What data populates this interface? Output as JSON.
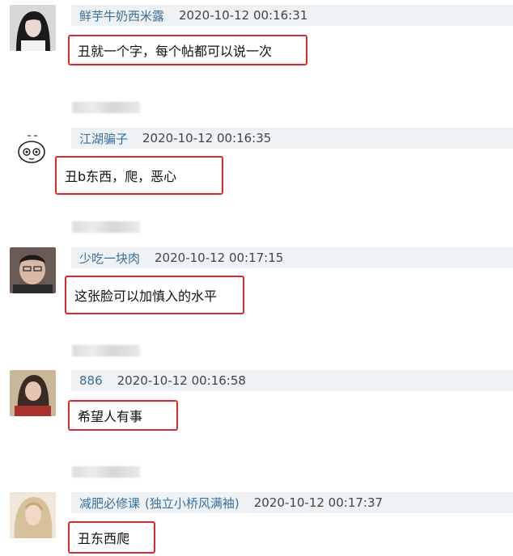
{
  "comments": [
    {
      "username": "鲜芋牛奶西米露",
      "username_suffix": "",
      "timestamp": "2020-10-12 00:16:31",
      "content": "丑就一个字，每个帖都可以说一次",
      "avatar_icon": "girl-portrait-avatar"
    },
    {
      "username": "江湖骗子",
      "username_suffix": "",
      "timestamp": "2020-10-12 00:16:35",
      "content": "丑b东西，爬，恶心",
      "avatar_icon": "cartoon-face-avatar"
    },
    {
      "username": "少吃一块肉",
      "username_suffix": "",
      "timestamp": "2020-10-12 00:17:15",
      "content": "这张脸可以加慎入的水平",
      "avatar_icon": "man-portrait-avatar"
    },
    {
      "username": "886",
      "username_suffix": "",
      "timestamp": "2020-10-12 00:16:58",
      "content": "希望人有事",
      "avatar_icon": "woman-portrait-avatar"
    },
    {
      "username": "减肥必修课",
      "username_suffix": "(独立小桥风满袖)",
      "timestamp": "2020-10-12 00:17:37",
      "content": "丑东西爬",
      "avatar_icon": "blonde-portrait-avatar"
    }
  ],
  "colors": {
    "username": "#3a6f9a",
    "highlight_border": "#d9282e",
    "header_bg": "#eef2f5"
  }
}
